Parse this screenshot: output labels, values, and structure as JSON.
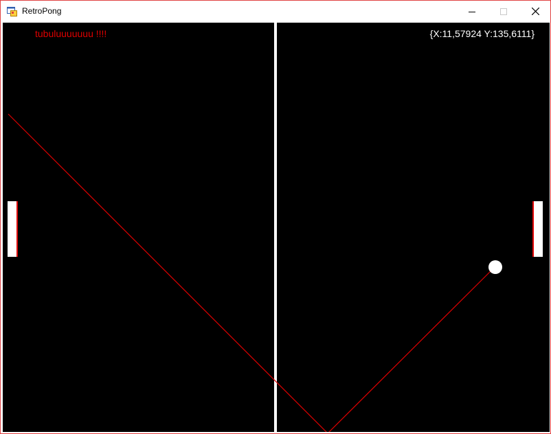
{
  "window": {
    "title": "RetroPong",
    "icon": "app-window-icon",
    "controls": {
      "minimize_icon": "minimize-icon",
      "maximize_icon": "maximize-icon",
      "close_icon": "close-icon"
    }
  },
  "game": {
    "status_message": "tubuluuuuuuu !!!!",
    "ball_position_readout": "{X:11,57924 Y:135,6111}",
    "colors": {
      "court_background": "#000000",
      "net": "#ffffff",
      "paddle": "#ffffff",
      "ball": "#ffffff",
      "trajectory": "#e00000",
      "status_message": "#e00000",
      "position_readout": "#ffffff"
    }
  }
}
